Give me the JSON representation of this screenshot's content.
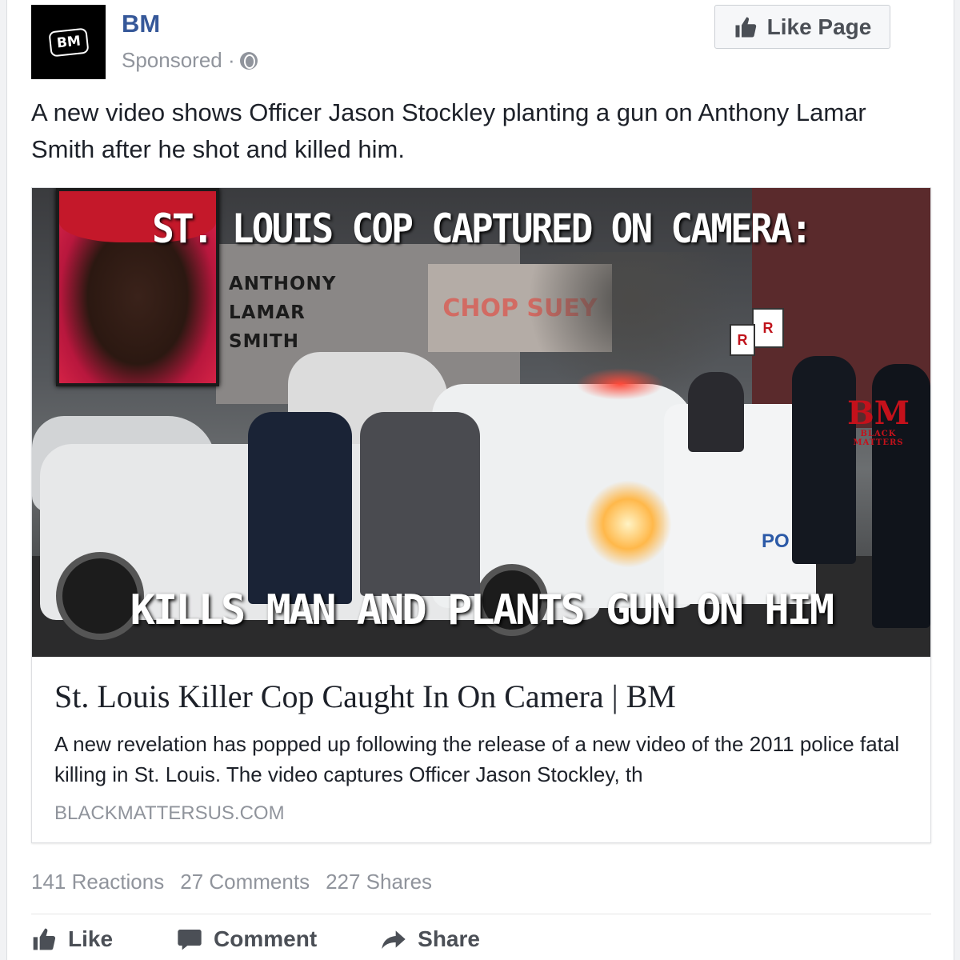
{
  "post": {
    "page_name": "BM",
    "avatar_text": "BM",
    "sponsored_label": "Sponsored ·",
    "like_page_label": "Like Page",
    "text": "A new video shows Officer Jason Stockley planting a gun on Anthony Lamar Smith after he shot and killed him."
  },
  "preview": {
    "image": {
      "headline": "ST. LOUIS COP CAPTURED ON CAMERA:",
      "victim_name": [
        "ANTHONY",
        "LAMAR",
        "SMITH"
      ],
      "subheadline": "KILLS MAN AND PLANTS GUN ON HIM",
      "watermark": "BM",
      "watermark_sub": "BLACK MATTERS",
      "sign_letter": "R",
      "store_sign": "CHOP SUEY",
      "car_door_text": "PO"
    },
    "title": "St. Louis Killer Cop Caught In On Camera | BM",
    "description": "A new revelation has popped up following the release of a new video of the 2011 police fatal killing in St. Louis. The video captures Officer Jason Stockley, th",
    "domain": "BLACKMATTERSUS.COM"
  },
  "stats": {
    "reactions": "141 Reactions",
    "comments": "27 Comments",
    "shares": "227 Shares"
  },
  "actions": {
    "like": "Like",
    "comment": "Comment",
    "share": "Share"
  },
  "colors": {
    "link_blue": "#365899",
    "muted": "#90949c",
    "text": "#1d2129",
    "accent_red": "#c4111b"
  },
  "icons": [
    "globe-icon",
    "thumbs-up-icon",
    "comment-icon",
    "share-icon"
  ]
}
